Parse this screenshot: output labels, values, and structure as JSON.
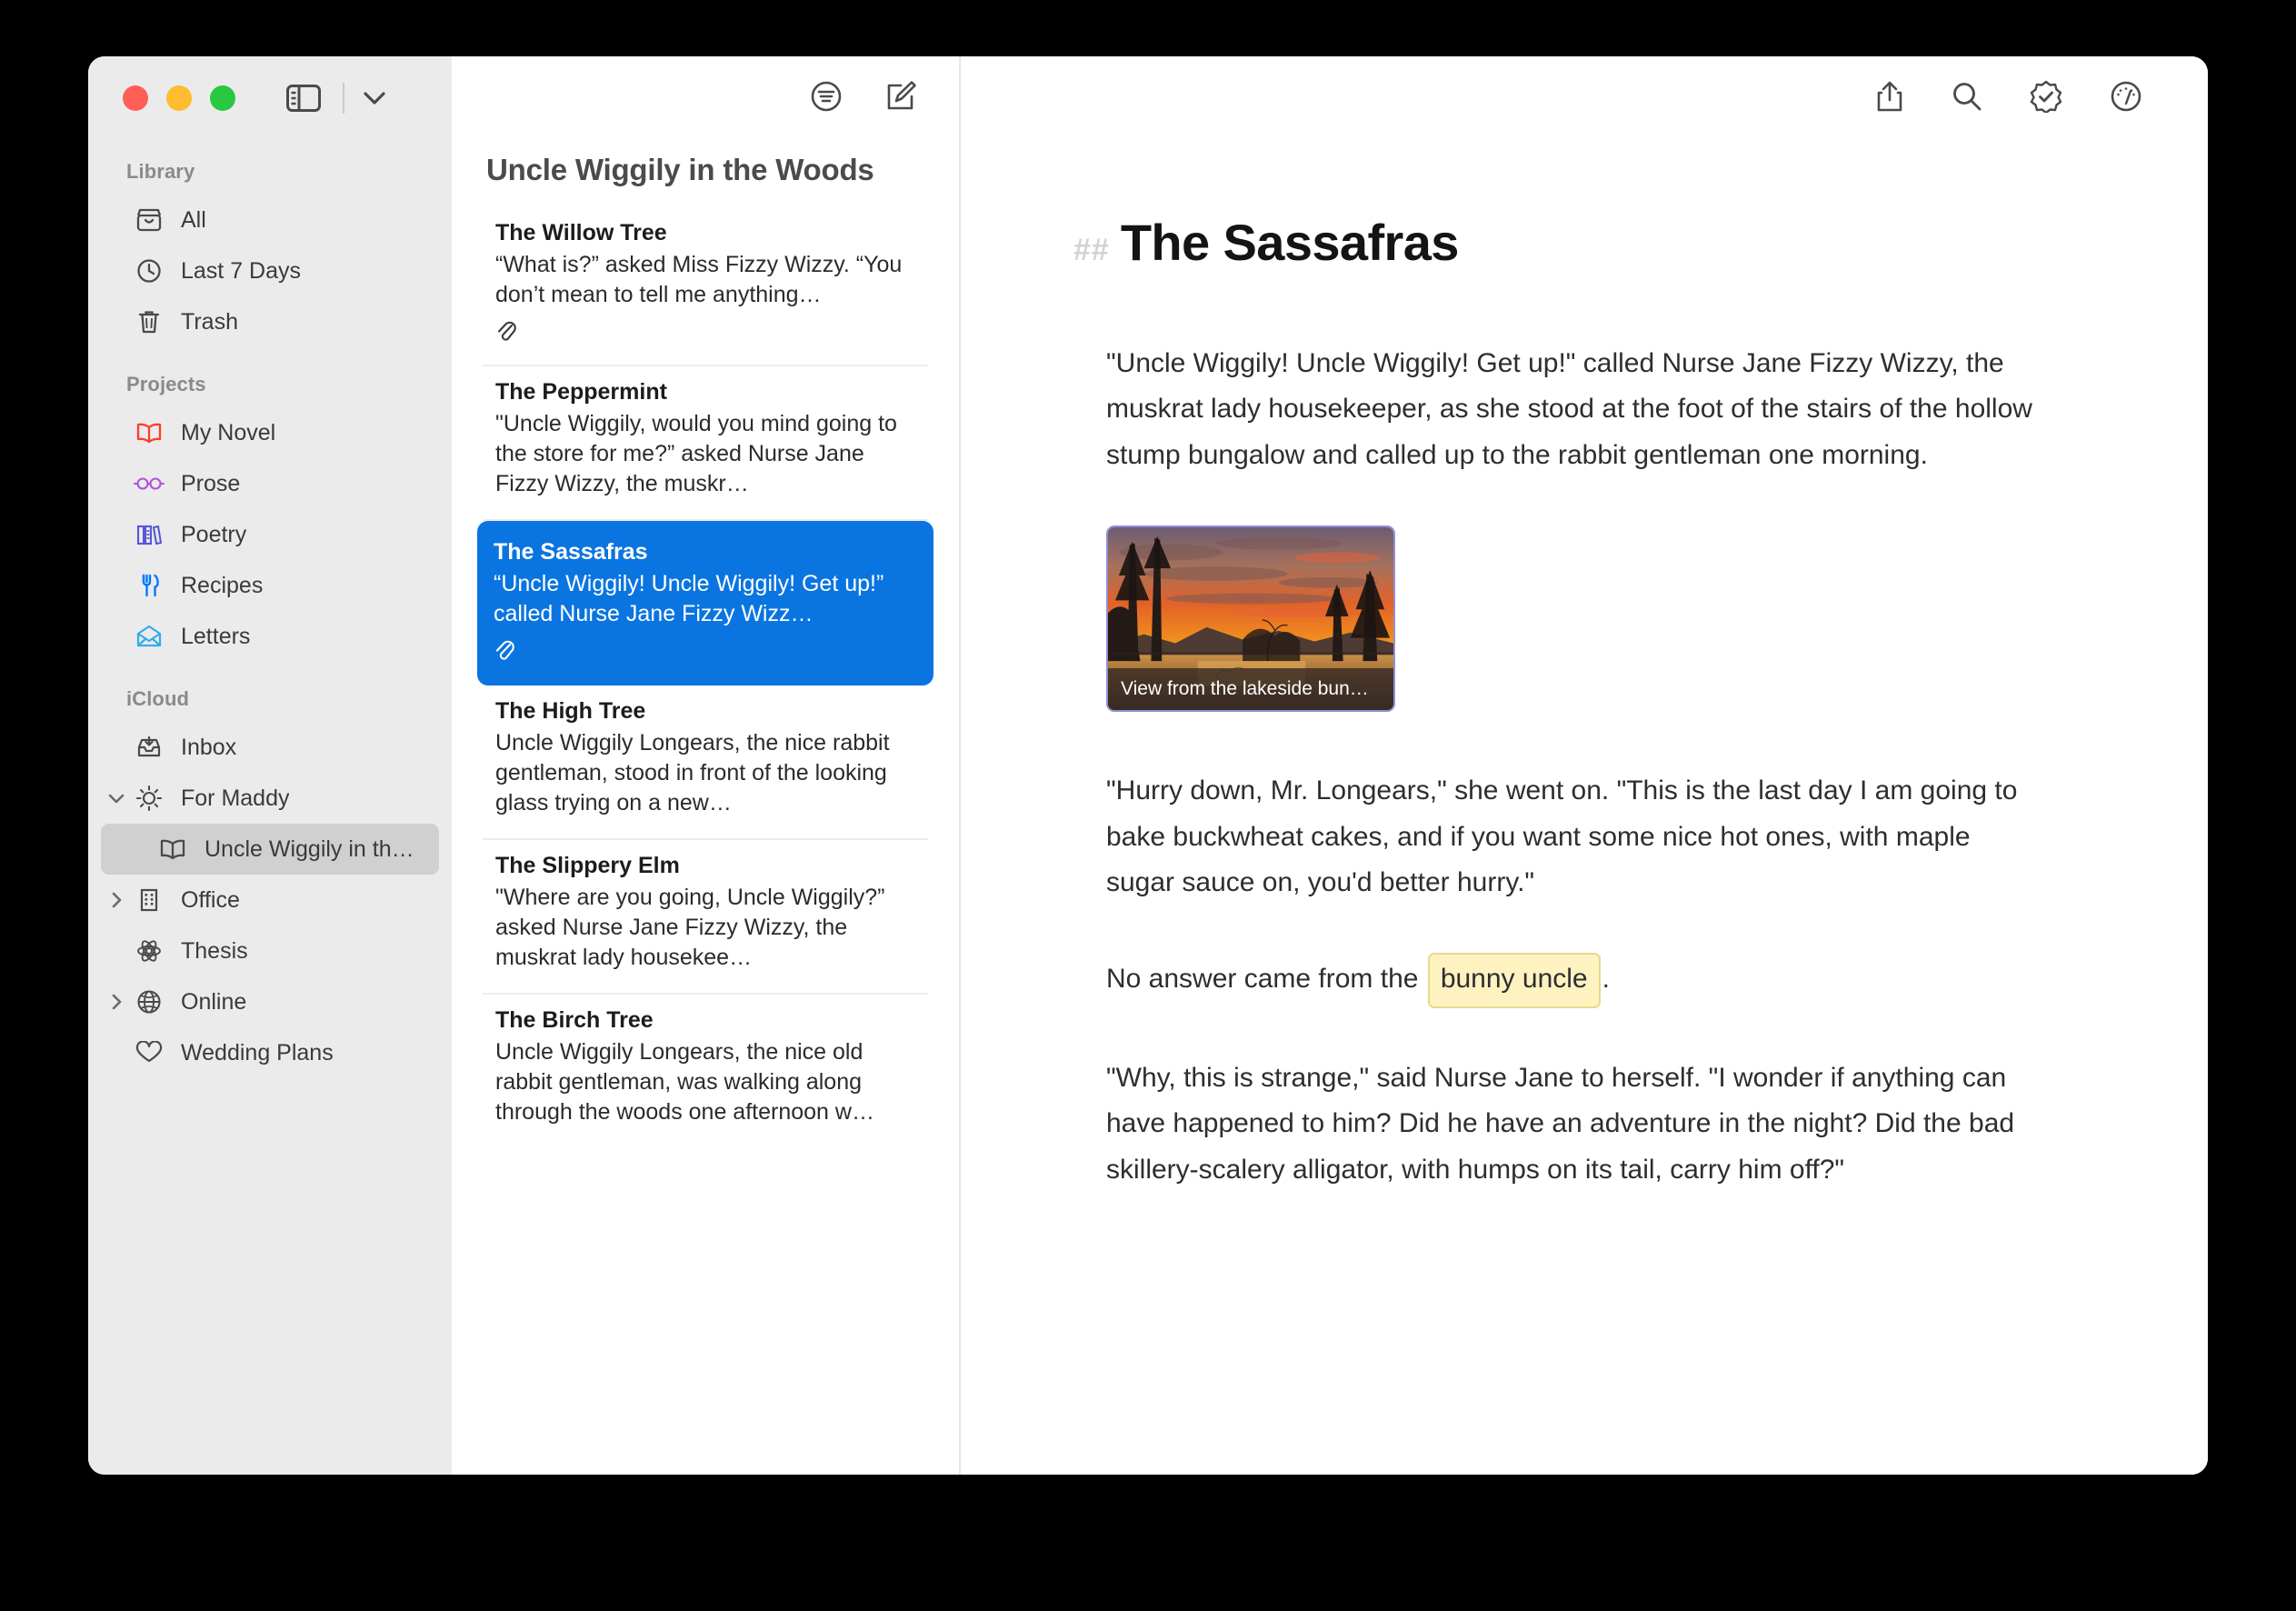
{
  "window": {
    "traffic_lights": [
      "close",
      "minimize",
      "zoom"
    ]
  },
  "sidebar": {
    "sections": [
      {
        "label": "Library",
        "items": [
          {
            "label": "All",
            "icon": "archivebox-icon"
          },
          {
            "label": "Last 7 Days",
            "icon": "clock-icon"
          },
          {
            "label": "Trash",
            "icon": "trash-icon"
          }
        ]
      },
      {
        "label": "Projects",
        "items": [
          {
            "label": "My Novel",
            "icon": "book-icon",
            "color": "#ff3b30"
          },
          {
            "label": "Prose",
            "icon": "glasses-icon",
            "color": "#af52de"
          },
          {
            "label": "Poetry",
            "icon": "books-icon",
            "color": "#5856d6"
          },
          {
            "label": "Recipes",
            "icon": "fork-knife-icon",
            "color": "#007aff"
          },
          {
            "label": "Letters",
            "icon": "envelope-open-icon",
            "color": "#32ade6"
          }
        ]
      },
      {
        "label": "iCloud",
        "items": [
          {
            "label": "Inbox",
            "icon": "tray-arrow-down-icon"
          },
          {
            "label": "For Maddy",
            "icon": "sun-icon",
            "twisty": "chevron-down"
          },
          {
            "label": "Uncle Wiggily in th…",
            "icon": "book-icon",
            "indent": true,
            "selected": true
          },
          {
            "label": "Office",
            "icon": "building-icon",
            "twisty": "chevron-right"
          },
          {
            "label": "Thesis",
            "icon": "atom-icon"
          },
          {
            "label": "Online",
            "icon": "globe-icon",
            "twisty": "chevron-right"
          },
          {
            "label": "Wedding Plans",
            "icon": "heart-icon"
          }
        ]
      }
    ]
  },
  "notelist": {
    "title": "Uncle Wiggily in the Woods",
    "toolbar": [
      {
        "name": "sort-filter-icon"
      },
      {
        "name": "compose-icon"
      }
    ],
    "notes": [
      {
        "title": "The Willow Tree",
        "preview": "“What is?” asked Miss Fizzy Wizzy. “You don’t mean to tell me anything…",
        "attachment": true,
        "selected": false
      },
      {
        "title": "The Peppermint",
        "preview": "\"Uncle Wiggily, would you mind going to the store for me?” asked Nurse Jane Fizzy Wizzy, the muskr…",
        "attachment": false,
        "selected": false
      },
      {
        "title": "The Sassafras",
        "preview": "“Uncle Wiggily! Uncle Wiggily! Get up!” called Nurse Jane Fizzy Wizz…",
        "attachment": true,
        "selected": true
      },
      {
        "title": "The High Tree",
        "preview": "Uncle Wiggily Longears, the nice rabbit gentleman, stood in front of the looking glass trying on a new…",
        "attachment": false,
        "selected": false
      },
      {
        "title": "The Slippery Elm",
        "preview": "\"Where are you going, Uncle Wiggily?” asked Nurse Jane Fizzy Wizzy, the muskrat lady housekee…",
        "attachment": false,
        "selected": false
      },
      {
        "title": "The Birch Tree",
        "preview": "Uncle Wiggily Longears, the nice old rabbit gentleman, was walking along through the woods one afternoon w…",
        "attachment": false,
        "selected": false
      }
    ]
  },
  "editor": {
    "toolbar": [
      {
        "name": "share-icon"
      },
      {
        "name": "search-icon"
      },
      {
        "name": "checkmark-seal-icon"
      },
      {
        "name": "gauge-info-icon"
      }
    ],
    "heading_marker": "##",
    "title": "The Sassafras",
    "paragraph1": "\"Uncle Wiggily! Uncle Wiggily! Get up!\" called Nurse Jane Fizzy Wizzy, the muskrat lady housekeeper, as she stood at the foot of the stairs of the hollow stump bungalow and called up to the rabbit gentleman one morning.",
    "image_caption": "View from the lakeside bun…",
    "paragraph2": "\"Hurry down, Mr. Longears,\" she went on. \"This is the last day I am going to bake buckwheat cakes, and if you want some nice hot ones, with maple sugar sauce on, you'd better hurry.\"",
    "paragraph3_before": "No answer came from the",
    "paragraph3_tag": "bunny uncle",
    "paragraph3_after": ".",
    "paragraph4": "\"Why, this is strange,\" said Nurse Jane to herself. \"I wonder if anything can have happened to him? Did he have an adventure in the night? Did the bad skillery-scalery alligator, with humps on its tail, carry him off?\""
  },
  "colors": {
    "selection_blue": "#0a75e0",
    "sidebar_bg": "#ebebeb",
    "highlight_yellow": "#fdf2c0"
  }
}
